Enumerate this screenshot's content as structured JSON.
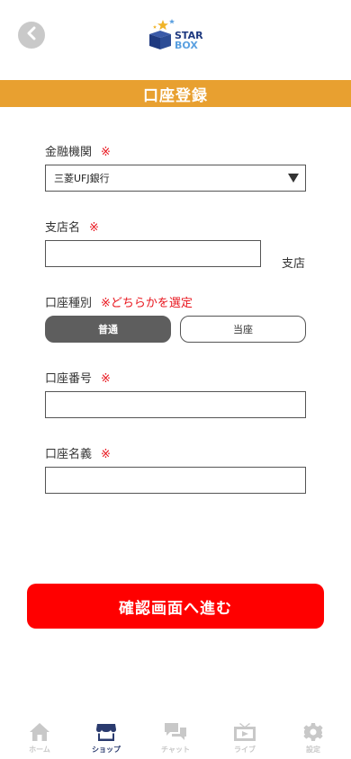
{
  "colors": {
    "accent": "#e8a030",
    "required": "#e8141c",
    "submit": "#ff0000",
    "tab_active": "#2a3a6e",
    "tab_inactive": "#c8c8c8"
  },
  "header": {
    "back_icon": "chevron-left-icon",
    "logo_text_top": "STAR",
    "logo_text_bottom": "BOX"
  },
  "page": {
    "title": "口座登録"
  },
  "form": {
    "required_mark": "※",
    "bank": {
      "label": "金融機関",
      "selected": "三菱UFJ銀行"
    },
    "branch": {
      "label": "支店名",
      "value": "",
      "suffix": "支店"
    },
    "account_type": {
      "label": "口座種別",
      "note": "※どちらかを選定",
      "options": [
        "普通",
        "当座"
      ],
      "selected": "普通"
    },
    "account_number": {
      "label": "口座番号",
      "value": ""
    },
    "account_name": {
      "label": "口座名義",
      "value": ""
    },
    "submit_label": "確認画面へ進む"
  },
  "tabbar": {
    "items": [
      {
        "label": "ホーム",
        "icon": "home-icon",
        "active": false
      },
      {
        "label": "ショップ",
        "icon": "shop-icon",
        "active": true
      },
      {
        "label": "チャット",
        "icon": "chat-icon",
        "active": false
      },
      {
        "label": "ライブ",
        "icon": "live-icon",
        "active": false
      },
      {
        "label": "設定",
        "icon": "gear-icon",
        "active": false
      }
    ]
  }
}
